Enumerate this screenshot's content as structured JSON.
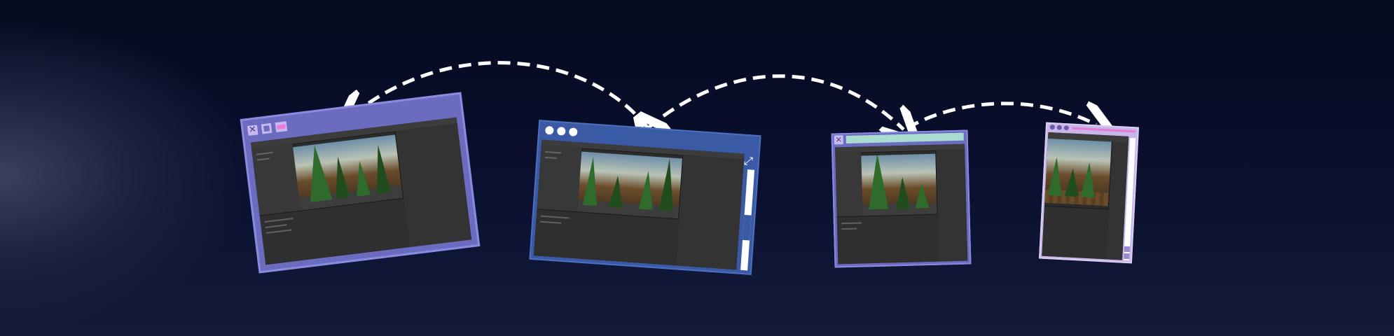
{
  "windows": [
    {
      "id": "window-1",
      "style": "purple",
      "frame_color": "#6b6cc0",
      "control_icons": [
        "close-icon",
        "maximize-icon",
        "minimize-icon"
      ]
    },
    {
      "id": "window-2",
      "style": "blue",
      "frame_color": "#3a5aa6",
      "control_icons": [
        "circle-icon",
        "circle-icon",
        "circle-icon",
        "expand-icon"
      ]
    },
    {
      "id": "window-3",
      "style": "mint",
      "frame_color": "#6b6cc0",
      "title_bar_color": "#a8dcd0",
      "control_icons": [
        "close-icon"
      ]
    },
    {
      "id": "window-4",
      "style": "lavender",
      "frame_color": "#c8b6e8",
      "control_icons": [
        "circle-icon",
        "circle-icon",
        "circle-icon"
      ]
    }
  ],
  "arrows": {
    "color": "#ffffff",
    "style": "dashed"
  }
}
